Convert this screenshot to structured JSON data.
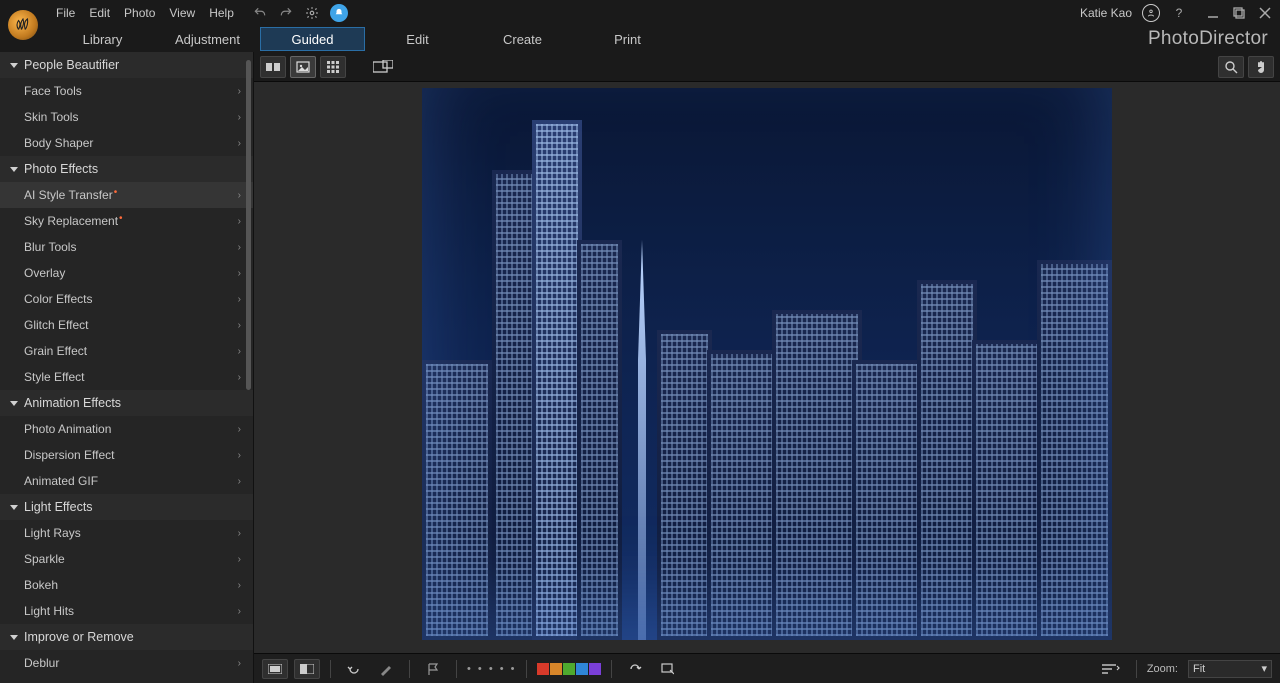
{
  "app": {
    "brand": "PhotoDirector"
  },
  "menus": {
    "file": "File",
    "edit": "Edit",
    "photo": "Photo",
    "view": "View",
    "help": "Help"
  },
  "user": {
    "name": "Katie Kao"
  },
  "modules": {
    "library": "Library",
    "adjustment": "Adjustment",
    "guided": "Guided",
    "edit": "Edit",
    "create": "Create",
    "print": "Print",
    "active": "Guided"
  },
  "sidebar": {
    "cats": {
      "people": "People Beautifier",
      "photo": "Photo Effects",
      "anim": "Animation Effects",
      "light": "Light Effects",
      "improve": "Improve or Remove"
    },
    "people": {
      "face": "Face Tools",
      "skin": "Skin Tools",
      "body": "Body Shaper"
    },
    "photo": {
      "ai": "AI Style Transfer",
      "sky": "Sky Replacement",
      "blur": "Blur Tools",
      "overlay": "Overlay",
      "color": "Color Effects",
      "glitch": "Glitch Effect",
      "grain": "Grain Effect",
      "style": "Style Effect"
    },
    "anim": {
      "photo": "Photo Animation",
      "disp": "Dispersion Effect",
      "gif": "Animated GIF"
    },
    "light": {
      "rays": "Light Rays",
      "sparkle": "Sparkle",
      "bokeh": "Bokeh",
      "hits": "Light Hits"
    },
    "improve": {
      "deblur": "Deblur"
    }
  },
  "bottom": {
    "zoom_label": "Zoom:",
    "zoom_value": "Fit"
  },
  "swatches": [
    "#d83a2a",
    "#d8862a",
    "#4faa2f",
    "#2f86d8",
    "#7a3fd8"
  ]
}
